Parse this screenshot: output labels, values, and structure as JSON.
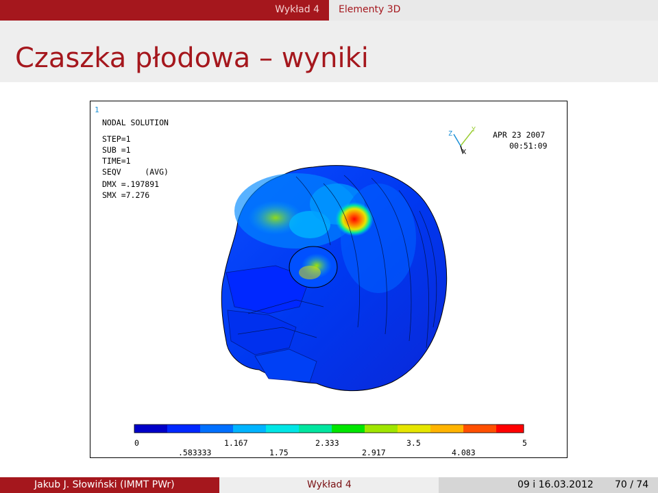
{
  "nav": {
    "section": "Wykład 4",
    "subsection": "Elementy 3D"
  },
  "title": "Czaszka płodowa – wyniki",
  "figure": {
    "window_number": "1",
    "header": "NODAL SOLUTION",
    "params": [
      "STEP=1",
      "SUB =1",
      "TIME=1",
      "SEQV     (AVG)",
      "DMX =.197891",
      "SMX =7.276"
    ],
    "date": "APR 23 2007",
    "time": "00:51:09",
    "axis_labels": {
      "z": "Z",
      "y": "Y",
      "x": "X"
    },
    "legend_top": [
      "0",
      "1.167",
      "2.333",
      "3.5",
      "5"
    ],
    "legend_bottom": [
      ".583333",
      "1.75",
      "2.917",
      "4.083"
    ],
    "colors": [
      "#0000c8",
      "#0028ff",
      "#0070ff",
      "#00b4ff",
      "#00e6e6",
      "#00e6a0",
      "#00e600",
      "#a0e600",
      "#e6e600",
      "#ffb400",
      "#ff5000",
      "#ff0000"
    ]
  },
  "footer": {
    "author": "Jakub J. Słowiński  (IMMT PWr)",
    "talk": "Wykład 4",
    "date": "09 i 16.03.2012",
    "page": "70 / 74"
  }
}
